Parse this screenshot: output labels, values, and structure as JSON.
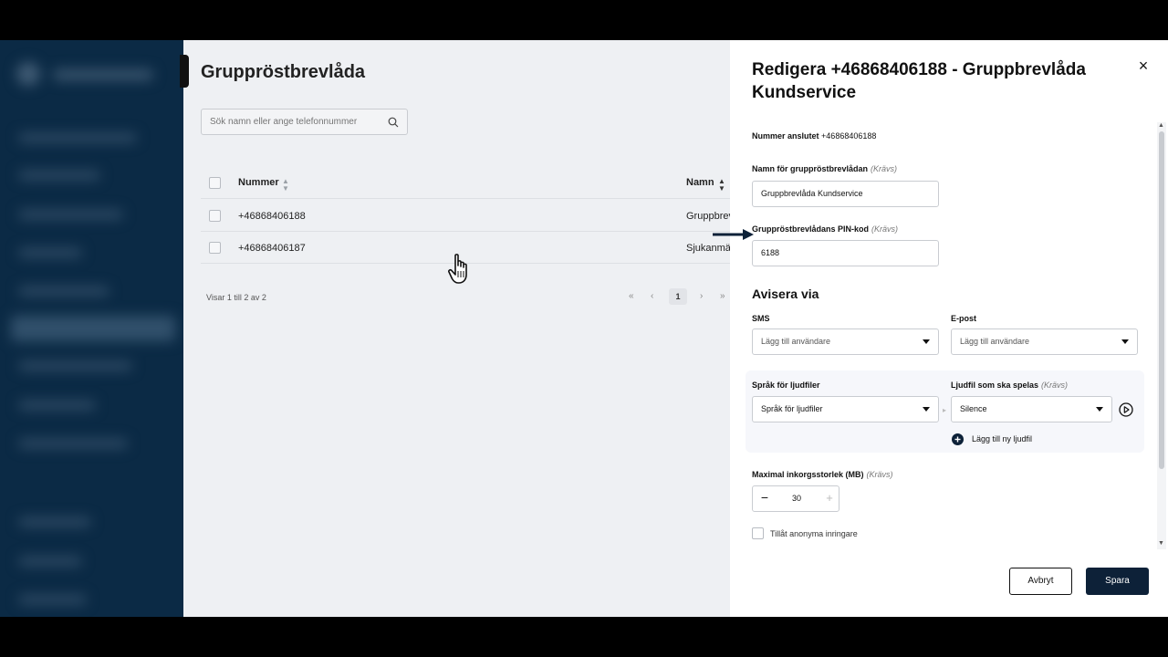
{
  "list_page": {
    "title": "Gruppröstbrevlåda",
    "search": {
      "placeholder": "Sök namn eller ange telefonnummer"
    },
    "columns": [
      "Nummer",
      "Namn"
    ],
    "rows": [
      {
        "number": "+46868406188",
        "name": "Gruppbrev"
      },
      {
        "number": "+46868406187",
        "name": "Sjukanmäl"
      }
    ],
    "pagination": {
      "info": "Visar 1 till 2 av 2",
      "first": "«",
      "prev": "‹",
      "current_page": "1",
      "next": "›",
      "last": "»"
    }
  },
  "drawer": {
    "title": "Redigera +46868406188 - Gruppbrevlåda Kundservice",
    "close": "×",
    "connected_number": {
      "label": "Nummer anslutet",
      "value": "+46868406188"
    },
    "required_tag": "(Krävs)",
    "mailbox_name": {
      "label": "Namn för gruppröstbrevlådan",
      "value": "Gruppbrevlåda Kundservice"
    },
    "pin": {
      "label": "Gruppröstbrevlådans PIN-kod",
      "value": "6188"
    },
    "notify_heading": "Avisera via",
    "sms": {
      "label": "SMS",
      "placeholder": "Lägg till användare"
    },
    "email": {
      "label": "E-post",
      "placeholder": "Lägg till användare"
    },
    "audio_language": {
      "label": "Språk för ljudfiler",
      "value": "Språk för ljudfiler"
    },
    "audio_file": {
      "label": "Ljudfil som ska spelas",
      "value": "Silence"
    },
    "add_audio_file": "Lägg till ny ljudfil",
    "max_inbox": {
      "label": "Maximal inkorgsstorlek (MB)",
      "value": "30",
      "minus": "−",
      "plus": "+"
    },
    "anonymous_callers": "Tillåt anonyma inringare",
    "cancel": "Avbryt",
    "save": "Spara"
  },
  "icons": [
    "search-icon",
    "sort-icon",
    "close-icon",
    "caret-down-icon",
    "play-icon",
    "plus-circle-icon",
    "hand-pointer-icon",
    "arrow-right-icon"
  ],
  "colors": {
    "sidebar": "#0b2a45",
    "primary_button": "#0d2138",
    "overlay_bg": "#eef0f3"
  }
}
